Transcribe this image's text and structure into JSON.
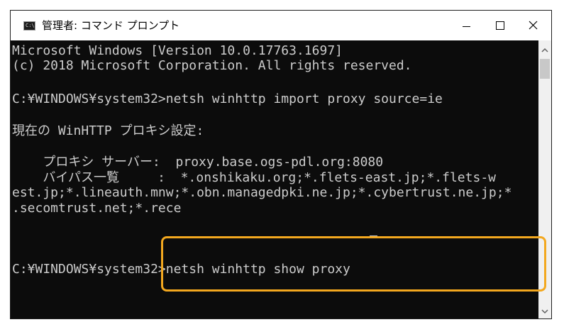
{
  "window": {
    "title": "管理者: コマンド プロンプト",
    "app_icon_text": "C:\\"
  },
  "terminal": {
    "lines": [
      "Microsoft Windows [Version 10.0.17763.1697]",
      "(c) 2018 Microsoft Corporation. All rights reserved.",
      "",
      "C:¥WINDOWS¥system32>netsh winhttp import proxy source=ie",
      "",
      "現在の WinHTTP プロキシ設定:",
      "",
      "    プロキシ サーバー:  proxy.base.ogs-pdl.org:8080",
      "    バイパス一覧     :  *.onshikaku.org;*.flets-east.jp;*.flets-w",
      "est.jp;*.lineauth.mnw;*.obn.managedpki.ne.jp;*.cybertrust.ne.jp;*",
      ".secomtrust.net;*.rece",
      "",
      "",
      "C:¥WINDOWS¥system32>netsh winhttp show proxy"
    ]
  },
  "colors": {
    "terminal_bg": "#0c0c0c",
    "terminal_text": "#cccccc",
    "highlight": "#f3a81f"
  },
  "icons": {
    "minimize": "minimize-icon",
    "maximize": "maximize-icon",
    "close": "close-icon",
    "scroll_up": "chevron-up-icon",
    "scroll_down": "chevron-down-icon"
  }
}
